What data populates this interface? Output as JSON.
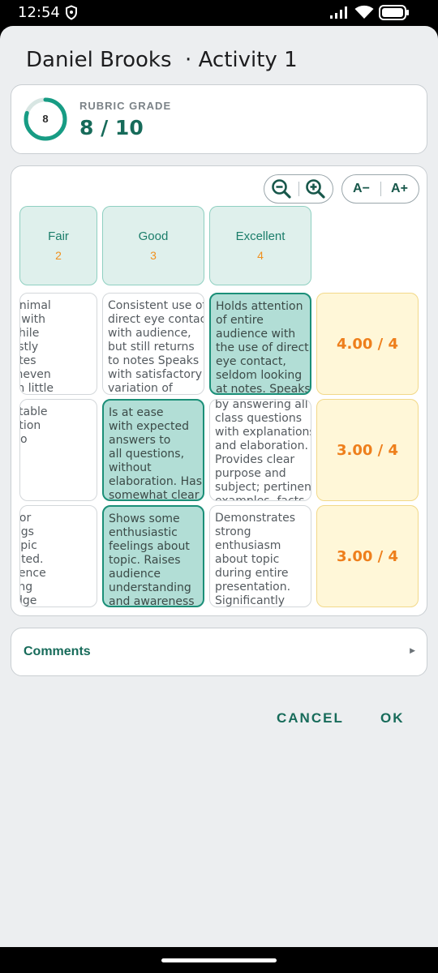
{
  "status": {
    "time": "12:54"
  },
  "dialog": {
    "student": "Daniel Brooks",
    "activity": "· Activity 1"
  },
  "grade": {
    "label": "RUBRIC GRADE",
    "ring_value": "8",
    "value": "8 / 10",
    "fraction": 0.8,
    "ring_color": "#179c84"
  },
  "toolbar": {
    "zoom_out_icon": "zoom-out-icon",
    "zoom_in_icon": "zoom-in-icon",
    "font_smaller": "A−",
    "font_larger": "A+"
  },
  "levels": [
    {
      "name": "Fair",
      "points": "2"
    },
    {
      "name": "Good",
      "points": "3"
    },
    {
      "name": "Excellent",
      "points": "4"
    }
  ],
  "rows": [
    {
      "fair": "plays minimal\n contact with\nience, while\nding mostly\nn the notes\naks in uneven\nume with little",
      "good": "Consistent use of\ndirect eye contact\nwith audience,\nbut still returns\nto notes Speaks\nwith satisfactory\nvariation of",
      "excellent": "Holds attention\nof entire\naudience with\nthe use of direct\neye contact,\nseldom looking\nat notes. Speaks",
      "score": "4.00 / 4",
      "selected": "excellent"
    },
    {
      "fair": "ncomfortable\n information\n is able to\nwer only\nmentary\nstions.\nmpts to",
      "good": "Is at ease\nwith expected\nanswers to\nall questions,\nwithout\nelaboration. Has\nsomewhat clear",
      "excellent": "by answering all\nclass questions\nwith explanations\nand elaboration.\nProvides clear\npurpose and\nsubject; pertinent\nexamples, facts",
      "score": "3.00 / 4",
      "selected": "good"
    },
    {
      "fair": "ws little or\ned feelings\nut the topic\ng presented.\nses audience\nerstanding\n knowledge",
      "good": "Shows some\nenthusiastic\nfeelings about\ntopic. Raises\naudience\nunderstanding\nand awareness",
      "excellent": "Demonstrates\nstrong\nenthusiasm\nabout topic\nduring entire\npresentation.\nSignificantly",
      "score": "3.00 / 4",
      "selected": "good"
    }
  ],
  "comments": {
    "label": "Comments",
    "arrow_icon": "caret-right-icon"
  },
  "actions": {
    "cancel": "CANCEL",
    "ok": "OK"
  }
}
